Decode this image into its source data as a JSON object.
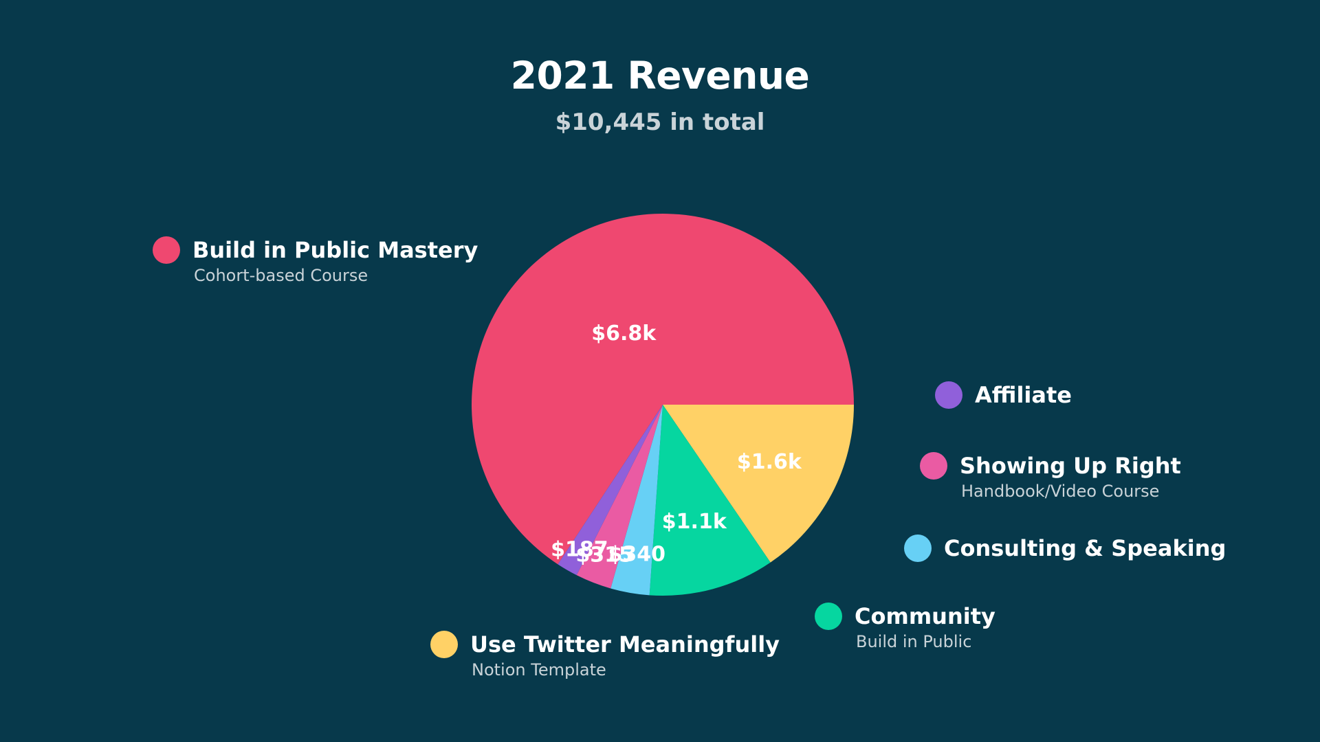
{
  "chart_data": {
    "type": "pie",
    "title": "2021 Revenue",
    "subtitle": "$10,445 in total",
    "slices": [
      {
        "name": "Build in Public Mastery",
        "subtitle": "Cohort-based Course",
        "value": 6800,
        "label": "$6.8k",
        "color": "#ef4870"
      },
      {
        "name": "Use Twitter Meaningfully",
        "subtitle": "Notion Template",
        "value": 1600,
        "label": "$1.6k",
        "color": "#ffd166"
      },
      {
        "name": "Community",
        "subtitle": "Build in Public",
        "value": 1100,
        "label": "$1.1k",
        "color": "#06d6a0"
      },
      {
        "name": "Consulting & Speaking",
        "subtitle": "",
        "value": 340,
        "label": "$340",
        "color": "#67d0f5"
      },
      {
        "name": "Showing Up Right",
        "subtitle": "Handbook/Video Course",
        "value": 315,
        "label": "$315",
        "color": "#ea5ba3"
      },
      {
        "name": "Affiliate",
        "subtitle": "",
        "value": 187,
        "label": "$187",
        "color": "#9060da"
      }
    ]
  }
}
